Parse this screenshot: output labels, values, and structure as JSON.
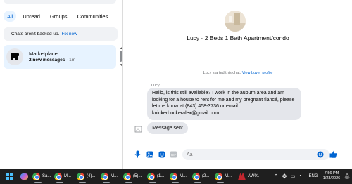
{
  "sidebar": {
    "filters": [
      {
        "label": "All",
        "active": true
      },
      {
        "label": "Unread",
        "active": false
      },
      {
        "label": "Groups",
        "active": false
      },
      {
        "label": "Communities",
        "active": false
      }
    ],
    "backup_notice": {
      "text": "Chats aren't backed up.",
      "link": "Fix now"
    },
    "conversation": {
      "name": "Marketplace",
      "new_messages": "2 new messages",
      "separator": " · ",
      "time": "1m",
      "icon": "storefront-icon"
    }
  },
  "chat": {
    "title": "Lucy · 2 Beds 1 Bath Apartment/condo",
    "started_text": "Lucy started this chat.",
    "started_link": "View buyer profile",
    "sender_name": "Lucy",
    "message_lines": [
      "Hello, is this still available? I work in the auburn area and am",
      "looking for a house to rent for me and my pregnant fiancé, please",
      "let me know at (843) 458-3736 or email",
      "knickerbockeralex@gmail.com"
    ],
    "message_2": "Message sent",
    "composer": {
      "placeholder": "Aa",
      "icons": [
        "microphone-icon",
        "image-icon",
        "sticker-icon",
        "gif-icon",
        "emoji-icon",
        "thumbs-up-icon"
      ]
    }
  },
  "colors": {
    "accent": "#0064d1",
    "chip_active_bg": "#e7f3ff",
    "bubble_bg": "#e4e6eb",
    "taskbar_bg": "#1f1f1f"
  },
  "taskbar": {
    "items": [
      {
        "label": "",
        "icon": "copilot-icon"
      },
      {
        "label": "Sa...",
        "icon": "chrome-icon"
      },
      {
        "label": "M...",
        "icon": "chrome-icon"
      },
      {
        "label": "(4)...",
        "icon": "chrome-icon"
      },
      {
        "label": "M...",
        "icon": "chrome-icon"
      },
      {
        "label": "(5)...",
        "icon": "chrome-icon"
      },
      {
        "label": "(1...",
        "icon": "chrome-icon"
      },
      {
        "label": "M...",
        "icon": "chrome-icon"
      },
      {
        "label": "(2...",
        "icon": "chrome-icon"
      },
      {
        "label": "M...",
        "icon": "chrome-icon"
      },
      {
        "label": "AW01",
        "icon": "app-icon"
      }
    ],
    "lang": "ENG",
    "time": "7:56 PM",
    "date": "1/23/2026"
  }
}
